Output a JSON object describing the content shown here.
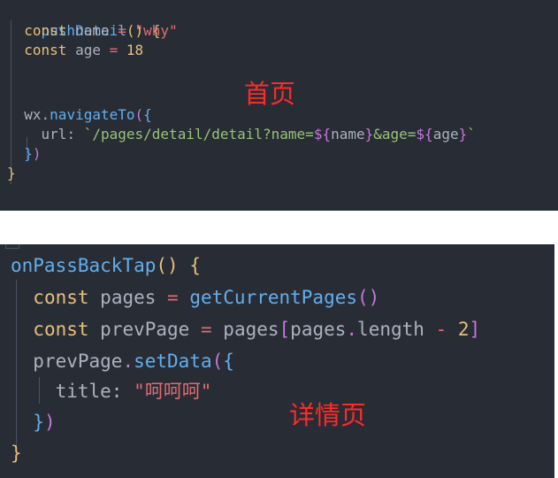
{
  "panel1": {
    "line1": {
      "fn": "pushDetail",
      "paren": "()",
      "brace": "{"
    },
    "line2": {
      "kw": "const",
      "var": "name",
      "op": "=",
      "str": "\"why\""
    },
    "line3": {
      "kw": "const",
      "var": "age",
      "op": "=",
      "num": "18"
    },
    "line5": {
      "obj": "wx",
      "dot": ".",
      "method": "navigateTo",
      "paren": "(",
      "brace": "{"
    },
    "line6": {
      "key": "url",
      "colon": ":",
      "tick": "`",
      "path": "/pages/detail/detail?name=",
      "dollar": "${",
      "v1": "name",
      "close1": "}",
      "amp": "&age=",
      "dollar2": "${",
      "v2": "age",
      "close2": "}",
      "tick2": "`"
    },
    "line7": {
      "brace": "}",
      "paren": ")"
    },
    "line8": {
      "brace": "}"
    },
    "label": "首页"
  },
  "panel2": {
    "line1": {
      "fn": "onPassBackTap",
      "paren": "()",
      "brace": "{"
    },
    "line2": {
      "kw": "const",
      "var": "pages",
      "op": "=",
      "call": "getCurrentPages",
      "paren": "()"
    },
    "line3": {
      "kw": "const",
      "var": "prevPage",
      "op": "=",
      "obj": "pages",
      "br_open": "[",
      "obj2": "pages",
      "dot": ".",
      "prop": "length",
      "minus": "-",
      "num": "2",
      "br_close": "]"
    },
    "line4": {
      "obj": "prevPage",
      "dot": ".",
      "method": "setData",
      "paren": "(",
      "brace": "{"
    },
    "line5": {
      "key": "title",
      "colon": ":",
      "str": "\"呵呵呵\""
    },
    "line6": {
      "brace": "}",
      "paren": ")"
    },
    "line7": {
      "brace": "}"
    },
    "label": "详情页"
  },
  "colors": {
    "background": "#282c34",
    "annotation": "#ff2a2a",
    "function": "#61afef",
    "keyword": "#e5c07b",
    "string": "#e06c75",
    "template": "#98c379",
    "operator": "#c678dd"
  }
}
